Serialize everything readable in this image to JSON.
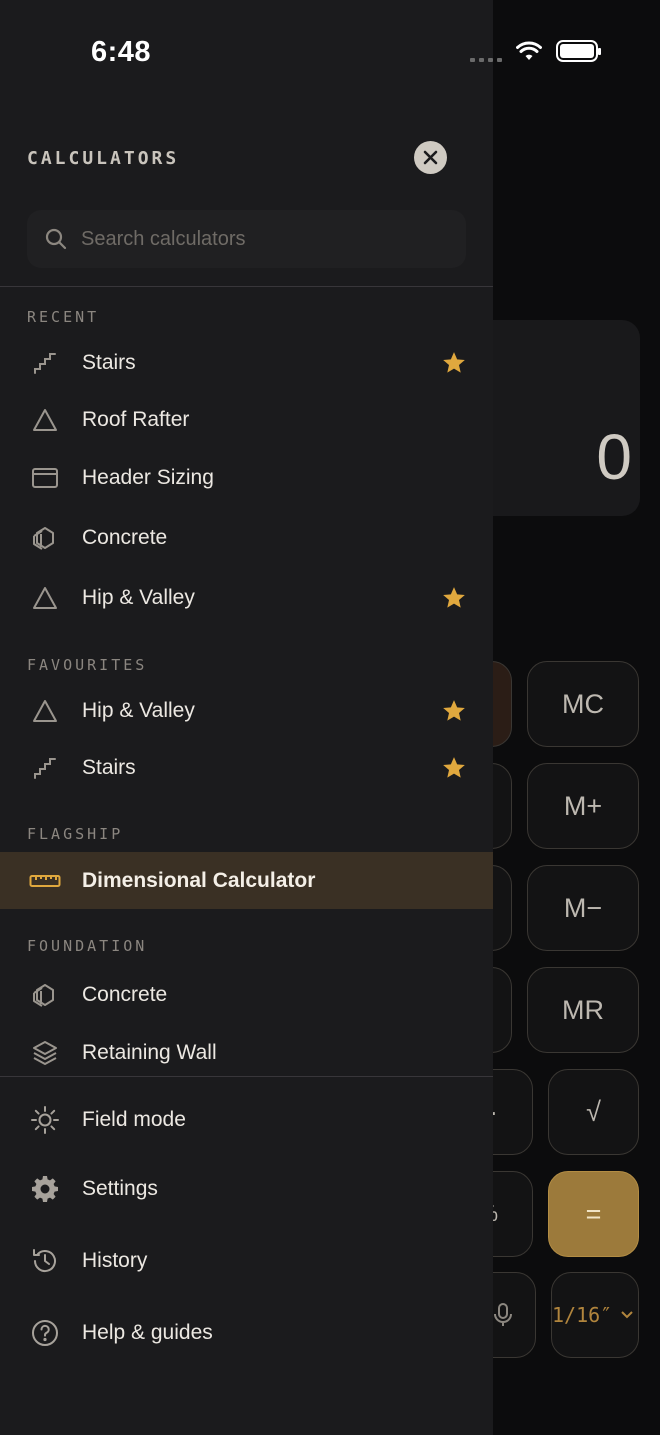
{
  "status": {
    "time": "6:48"
  },
  "drawer": {
    "title": "CALCULATORS",
    "search_placeholder": "Search calculators",
    "sections": {
      "recent": {
        "label": "RECENT",
        "items": [
          {
            "label": "Stairs",
            "icon": "stairs-icon",
            "starred": true
          },
          {
            "label": "Roof Rafter",
            "icon": "triangle-icon",
            "starred": false
          },
          {
            "label": "Header Sizing",
            "icon": "header-icon",
            "starred": false
          },
          {
            "label": "Concrete",
            "icon": "concrete-icon",
            "starred": false
          },
          {
            "label": "Hip & Valley",
            "icon": "triangle-icon",
            "starred": true
          }
        ]
      },
      "favourites": {
        "label": "FAVOURITES",
        "items": [
          {
            "label": "Hip & Valley",
            "icon": "triangle-icon",
            "starred": true
          },
          {
            "label": "Stairs",
            "icon": "stairs-icon",
            "starred": true
          }
        ]
      },
      "flagship": {
        "label": "FLAGSHIP",
        "items": [
          {
            "label": "Dimensional Calculator",
            "icon": "ruler-icon",
            "active": true
          }
        ]
      },
      "foundation": {
        "label": "FOUNDATION",
        "items": [
          {
            "label": "Concrete",
            "icon": "concrete-icon"
          },
          {
            "label": "Retaining Wall",
            "icon": "layers-icon"
          }
        ]
      }
    },
    "footer": [
      {
        "label": "Field mode",
        "icon": "sun-icon"
      },
      {
        "label": "Settings",
        "icon": "gear-icon"
      },
      {
        "label": "History",
        "icon": "history-icon"
      },
      {
        "label": "Help & guides",
        "icon": "help-icon"
      }
    ]
  },
  "background": {
    "display_value": "0",
    "keys": {
      "mc": "MC",
      "mplus": "M+",
      "mminus": "M−",
      "mr": "MR",
      "sqrt": "√",
      "equals": "=",
      "fraction": "1/16″",
      "dot": "·",
      "percent": "%"
    }
  },
  "colors": {
    "accent": "#e0a83e",
    "active_bg": "#3a3024",
    "drawer_bg": "#1b1b1d"
  }
}
